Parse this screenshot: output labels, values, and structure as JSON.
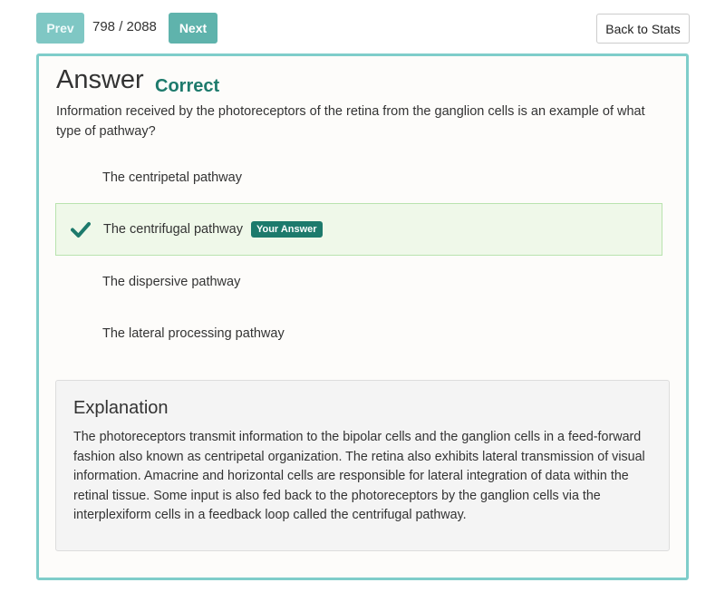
{
  "nav": {
    "prev_label": "Prev",
    "counter": "798 / 2088",
    "next_label": "Next",
    "back_label": "Back to Stats"
  },
  "answer": {
    "title": "Answer",
    "status": "Correct",
    "status_color": "#1d7a6c",
    "question": "Information received by the photoreceptors of the retina from the ganglion cells is an example of what type of pathway?",
    "options": [
      {
        "label": "The centripetal pathway",
        "selected": false
      },
      {
        "label": "The centrifugal pathway",
        "selected": true,
        "icon": "check-icon",
        "badge": "Your Answer"
      },
      {
        "label": "The dispersive pathway",
        "selected": false
      },
      {
        "label": "The lateral processing pathway",
        "selected": false
      }
    ]
  },
  "explanation": {
    "title": "Explanation",
    "body": "The photoreceptors transmit information to the bipolar cells and the ganglion cells in a feed-forward fashion also known as centripetal organization. The retina also exhibits lateral transmission of visual information. Amacrine and horizontal cells are responsible for lateral integration of data within the retinal tissue. Some input is also fed back to the photoreceptors by the ganglion cells via the interplexiform cells in a feedback loop called the centrifugal pathway."
  },
  "colors": {
    "accent": "#7fcdca",
    "correct": "#1d7a6c",
    "selected_bg": "#eff8e9"
  }
}
